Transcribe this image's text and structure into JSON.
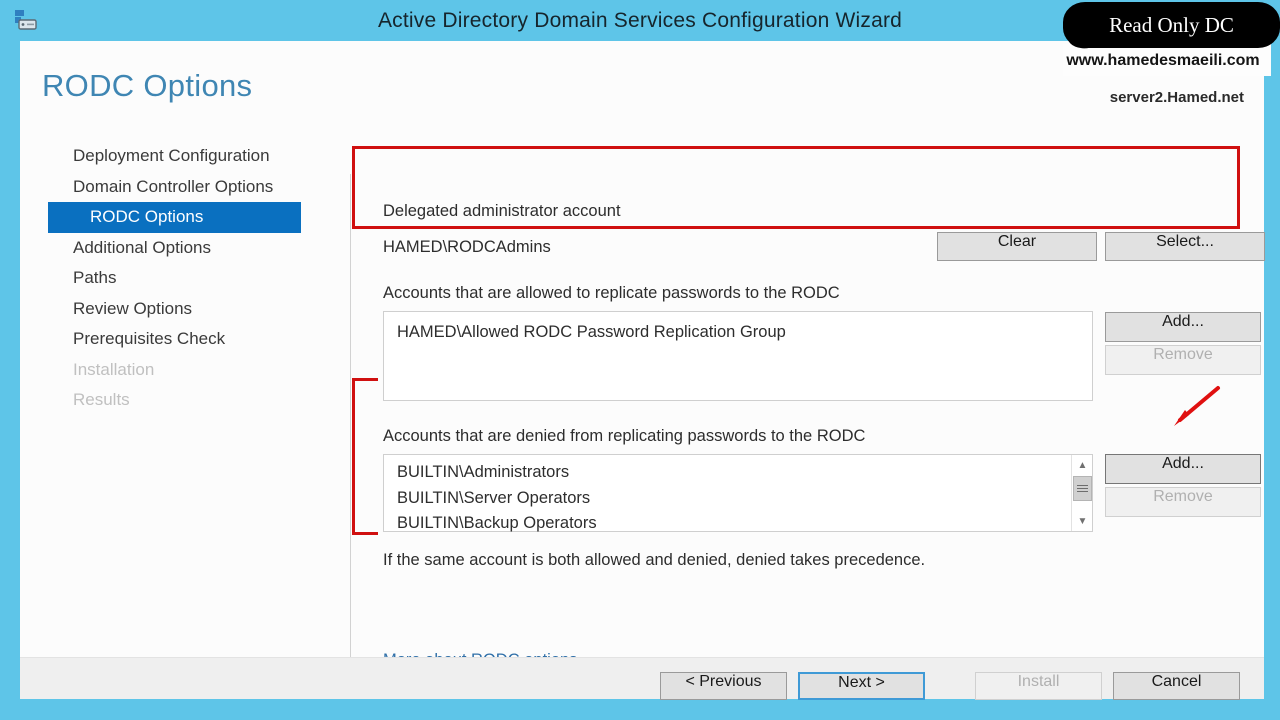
{
  "window": {
    "title": "Active Directory Domain Services Configuration Wizard",
    "icon": "server-dc-icon"
  },
  "header": {
    "page_title": "RODC Options",
    "server_name": "server2.Hamed.net"
  },
  "sidebar": {
    "items": [
      {
        "label": "Deployment Configuration",
        "state": "enabled",
        "indent": false
      },
      {
        "label": "Domain Controller Options",
        "state": "enabled",
        "indent": false
      },
      {
        "label": "RODC Options",
        "state": "active",
        "indent": true
      },
      {
        "label": "Additional Options",
        "state": "enabled",
        "indent": false
      },
      {
        "label": "Paths",
        "state": "enabled",
        "indent": false
      },
      {
        "label": "Review Options",
        "state": "enabled",
        "indent": false
      },
      {
        "label": "Prerequisites Check",
        "state": "enabled",
        "indent": false
      },
      {
        "label": "Installation",
        "state": "disabled",
        "indent": false
      },
      {
        "label": "Results",
        "state": "disabled",
        "indent": false
      }
    ]
  },
  "delegated_admin": {
    "label": "Delegated administrator account",
    "value": "HAMED\\RODCAdmins",
    "clear_label": "Clear",
    "select_label": "Select..."
  },
  "allowed": {
    "label": "Accounts that are allowed to replicate passwords to the RODC",
    "items": [
      "HAMED\\Allowed RODC Password Replication Group"
    ],
    "add_label": "Add...",
    "remove_label": "Remove"
  },
  "denied": {
    "label": "Accounts that are denied from replicating passwords to the RODC",
    "items": [
      "BUILTIN\\Administrators",
      "BUILTIN\\Server Operators",
      "BUILTIN\\Backup Operators"
    ],
    "add_label": "Add...",
    "remove_label": "Remove",
    "note": "If the same account is both allowed and denied, denied takes precedence."
  },
  "more_link": {
    "label": "More about RODC options"
  },
  "footer": {
    "previous_label": "< Previous",
    "next_label": "Next >",
    "install_label": "Install",
    "cancel_label": "Cancel"
  },
  "overlays": {
    "blackout_text": "Read Only DC",
    "watermark": "www.hamedesmaeili.com"
  },
  "colors": {
    "titlebar": "#5ec5e8",
    "accent_blue": "#0a70c0",
    "heading_blue": "#3f86b3",
    "link_blue": "#2f6fa8",
    "annotation_red": "#d01010"
  }
}
